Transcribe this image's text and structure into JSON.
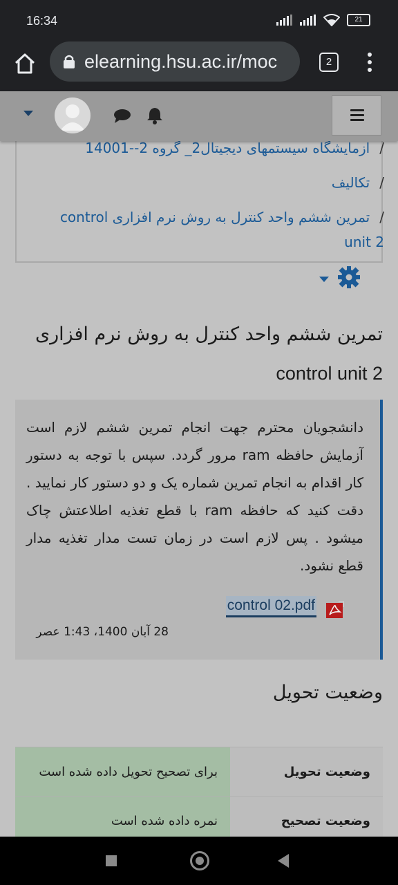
{
  "status_bar": {
    "time": "16:34",
    "battery": "21"
  },
  "browser": {
    "url": "elearning.hsu.ac.ir/moc",
    "tab_count": "2"
  },
  "breadcrumb": [
    {
      "sep": "/",
      "label": "ازمایشگاه سیستمهای دیجیتال2_ گروه 2--14001"
    },
    {
      "sep": "/",
      "label": "تکالیف"
    },
    {
      "sep": "/",
      "label": "تمرین ششم واحد کنترل به روش نرم افزاری control unit 2"
    }
  ],
  "page": {
    "title_fa": "تمرین ششم واحد کنترل به روش نرم افزاری",
    "title_en": "control unit 2"
  },
  "description": {
    "text": "دانشجویان محترم جهت انجام تمرین ششم لازم است آزمایش حافظه ram  مرور گردد. سپس با توجه به دستور کار اقدام به انجام تمرین شماره یک و دو دستور کار نمایید . دقت کنید که حافظه ram با قطع تغذیه اطلاعتش چاک میشود . پس لازم است در زمان تست مدار تغذیه مدار قطع نشود.",
    "file_name": "control 02.pdf",
    "file_date": "28 آبان 1400، 1:43 عصر"
  },
  "submission": {
    "heading": "وضعیت تحویل",
    "rows": [
      {
        "label": "وضعیت تحویل",
        "value": "برای تصحیح تحویل داده شده است"
      },
      {
        "label": "وضعیت تصحیح",
        "value": "نمره داده شده است"
      }
    ]
  },
  "colors": {
    "link": "#1b5a96",
    "accent_border": "#1b5a96",
    "status_green": "#a4bda4"
  },
  "icons": [
    "home-icon",
    "lock-icon",
    "tabs-icon",
    "more-vert-icon",
    "chat-icon",
    "bell-icon",
    "hamburger-icon",
    "gear-icon",
    "pdf-icon"
  ]
}
